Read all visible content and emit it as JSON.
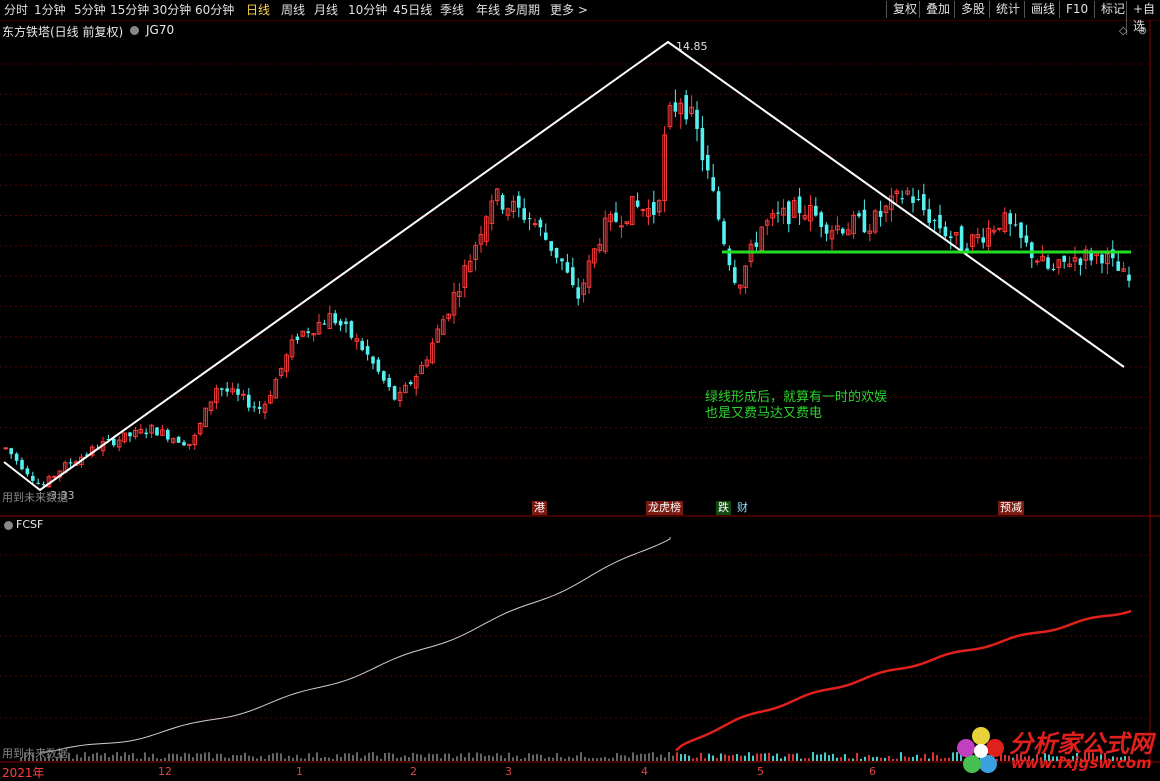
{
  "toolbar": {
    "periods": [
      "分时",
      "1分钟",
      "5分钟",
      "15分钟",
      "30分钟",
      "60分钟",
      "日线",
      "周线",
      "月线",
      "10分钟",
      "45日线",
      "季线",
      "年线",
      "多周期",
      "更多 >"
    ],
    "active_period": "日线",
    "right_buttons": [
      "复权",
      "叠加",
      "多股",
      "统计",
      "画线",
      "F10",
      "标记",
      "+自选"
    ]
  },
  "chart": {
    "stock_title": "东方铁塔(日线 前复权)",
    "main_indicator": "JG70",
    "sub_indicator": "FCSF",
    "peak_value": "14.85",
    "low_value": "3.33",
    "future_data_note": "用到未来数据",
    "annotation_line1": "绿线形成后，就算有一时的欢娱",
    "annotation_line2": "也是又费马达又费电",
    "events": [
      {
        "text": "港",
        "style": "red"
      },
      {
        "text": "龙虎榜",
        "style": "red"
      },
      {
        "text": "跌",
        "style": "green"
      },
      {
        "text": "财",
        "style": "blue"
      },
      {
        "text": "预减",
        "style": "red"
      }
    ],
    "x_axis": {
      "year_label": "2021年",
      "month_labels": [
        "12",
        "1",
        "2",
        "3",
        "4",
        "5",
        "6"
      ]
    },
    "colors": {
      "up": "#ff3b3b",
      "down": "#54f0f0",
      "trend_line": "#ffffff",
      "support_line": "#22dd22",
      "sub_line_1": "#cfcfcf",
      "sub_line_2": "#e0201c"
    }
  },
  "watermark": {
    "title": "分析家公式网",
    "url": "www.fxjgsw.com"
  }
}
